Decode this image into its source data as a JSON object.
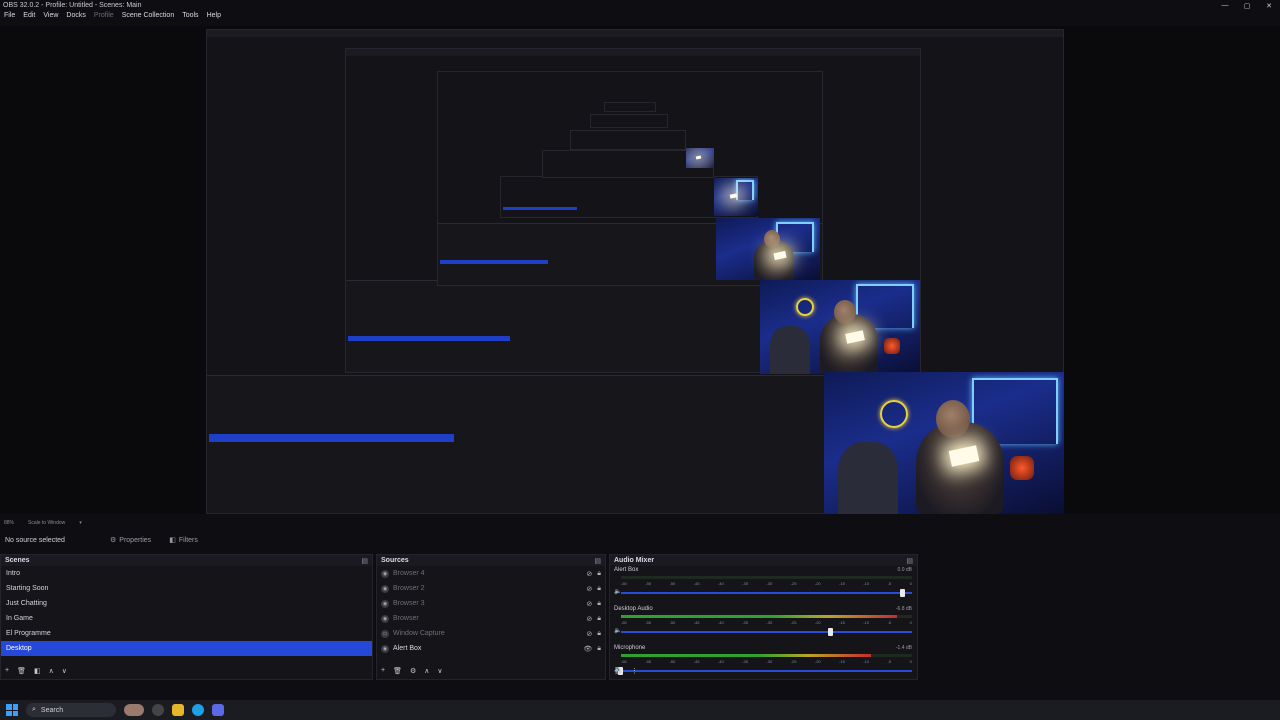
{
  "window": {
    "title": "OBS 32.0.2 - Profile: Untitled - Scenes: Main",
    "controls": [
      "—",
      "▢",
      "✕"
    ]
  },
  "menu": [
    "File",
    "Edit",
    "View",
    "Docks",
    "Profile",
    "Scene Collection",
    "Tools",
    "Help"
  ],
  "preview_toolbar": {
    "zoom": "88%",
    "scale": "Scale to Window"
  },
  "context_bar": {
    "no_source": "No source selected",
    "properties": "Properties",
    "filters": "Filters"
  },
  "scenes": {
    "title": "Scenes",
    "items": [
      "Intro",
      "Starting Soon",
      "Just Chatting",
      "In Game",
      "El Programme",
      "Desktop"
    ],
    "selected": "Desktop"
  },
  "sources": {
    "title": "Sources",
    "items": [
      {
        "label": "Browser 4",
        "visible": false
      },
      {
        "label": "Browser 2",
        "visible": false
      },
      {
        "label": "Browser 3",
        "visible": false
      },
      {
        "label": "Browser",
        "visible": false
      },
      {
        "label": "Window Capture",
        "visible": false
      },
      {
        "label": "Alert Box",
        "visible": true
      }
    ]
  },
  "mixer": {
    "title": "Audio Mixer",
    "channels": [
      {
        "name": "Alert Box",
        "db": "0.0 dB",
        "level": 0.0,
        "fader": 0.97
      },
      {
        "name": "Desktop Audio",
        "db": "-6.8 dB",
        "level": 0.95,
        "fader": 0.72
      },
      {
        "name": "Microphone",
        "db": "-1.4 dB",
        "level": 0.86,
        "fader": 0.0
      }
    ],
    "ticks": [
      "-60",
      "-55",
      "-50",
      "-45",
      "-40",
      "-35",
      "-30",
      "-25",
      "-20",
      "-15",
      "-10",
      "-5",
      "0"
    ]
  },
  "taskbar": {
    "search": "Search"
  },
  "colors": {
    "accent": "#2548d8",
    "neon": "#7ed0ff"
  }
}
